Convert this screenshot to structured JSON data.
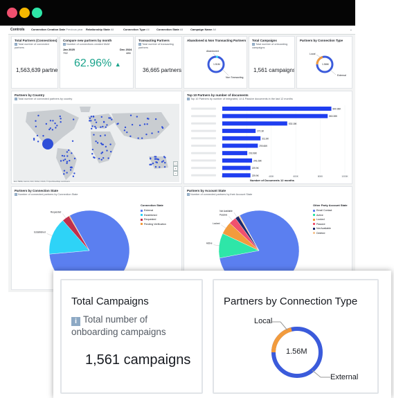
{
  "window": {
    "controls": [
      "close",
      "minimize",
      "maximize"
    ]
  },
  "controls_bar": {
    "title": "Controls",
    "filters": [
      {
        "label": "Connection Creation Date",
        "value": "Previous year"
      },
      {
        "label": "Relationship State",
        "value": "All"
      },
      {
        "label": "Connection Type",
        "value": "All"
      },
      {
        "label": "Connection State",
        "value": "All"
      },
      {
        "label": "Campaign Name",
        "value": "All"
      }
    ]
  },
  "kpis": {
    "total_partners": {
      "title": "Total Partners (Connections)",
      "subtitle": "Total number of connected partners",
      "value": "1,563,639 partners"
    },
    "compare": {
      "title": "Compare new partners by month",
      "subtitle": "Number of connections created MoM",
      "from_label": "Jan 2025",
      "from_value": "792",
      "to_label": "Dec 2024",
      "to_value": "486",
      "change": "62.96%",
      "arrow": "▲"
    },
    "transacting": {
      "title": "Transacting Partners",
      "subtitle": "Total number of transacting partners",
      "value": "36,665 partners"
    },
    "abandoned": {
      "title": "Abandoned & Non Transacting Partners",
      "label_top": "Abandoned",
      "label_bottom": "Non Transacting",
      "center": "1.51M"
    },
    "total_campaigns": {
      "title": "Total Campaigns",
      "subtitle": "Total number of onboarding campaigns",
      "value": "1,561 campaigns"
    },
    "conn_type": {
      "title": "Partners by Connection Type",
      "label_local": "Local",
      "label_external": "External",
      "center": "1.56M"
    }
  },
  "map": {
    "title": "Partners by Country",
    "subtitle": "Total number of connected partners by country",
    "attribution": "Esri, HERE, Garmin, FAO, NOAA, USGS, © OpenStreetMap contributors"
  },
  "top10": {
    "title": "Top 10 Partners by number of documents",
    "subtitle": "Top 10 Partners by number of Integrated, UI & Passive documents in the last 12 months"
  },
  "chart_data": [
    {
      "type": "bar",
      "title": "Top 10 Partners by number of documents",
      "xlabel": "Number of Documents 12 months",
      "ylabel": "",
      "xlim": [
        0,
        1000000
      ],
      "ticks": [
        "0",
        "200K",
        "400K",
        "600K",
        "800K",
        "1000K"
      ],
      "categories": [
        "",
        "",
        "",
        "",
        "",
        "",
        "",
        "",
        "",
        ""
      ],
      "values": [
        890000,
        860000,
        530000,
        272000,
        312000,
        290000,
        204000,
        243000,
        230000,
        230000
      ],
      "data_labels": [
        "890.96K",
        "860.38K",
        "533.18K",
        "272.3K",
        "311.8K",
        "290.66K",
        "203.98K",
        "243.28K",
        "229.9K",
        "229.9K"
      ]
    },
    {
      "type": "pie",
      "title": "Partners by Connection State",
      "subtitle": "Number of connected partners by Connection State",
      "legend_title": "Connection State",
      "categories": [
        "External",
        "Established",
        "Requested",
        "Pending Verification"
      ],
      "values": [
        82,
        15,
        3,
        0.3
      ],
      "colors": [
        "#5b7ff0",
        "#2ed3f7",
        "#c0304b",
        "#f29b3d"
      ]
    },
    {
      "type": "pie",
      "title": "Partners by Account State",
      "subtitle": "Number of connected partners by their Account State",
      "legend_title": "Other Party Account State",
      "categories": [
        "Email Contact",
        "Active",
        "Locked",
        "Passive",
        "Not Available",
        "Deleted"
      ],
      "values": [
        80,
        10,
        5,
        3,
        1.5,
        0.5
      ],
      "colors": [
        "#5b7ff0",
        "#2ee6a8",
        "#f29b3d",
        "#f0506e",
        "#1b2a6b",
        "#f7c99a"
      ]
    }
  ],
  "zoom": {
    "campaigns_title": "Total Campaigns",
    "campaigns_subtitle": "Total number of onboarding campaigns",
    "campaigns_value": "1,561 campaigns",
    "conn_title": "Partners by Connection Type",
    "conn_center": "1.56M",
    "conn_local": "Local",
    "conn_external": "External"
  },
  "colors": {
    "primary": "#3b5bdb",
    "positive": "#1aa38b",
    "teal": "#2ed3f7"
  }
}
